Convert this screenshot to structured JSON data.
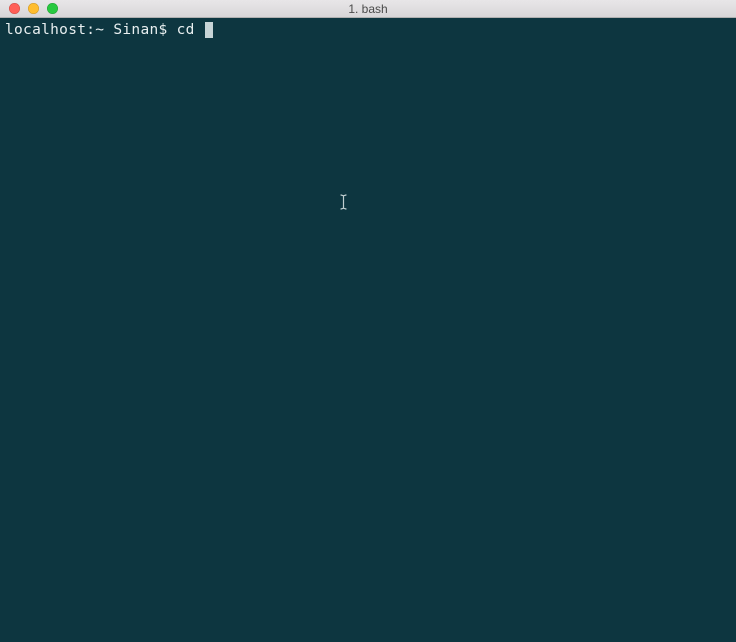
{
  "titlebar": {
    "title": "1. bash"
  },
  "terminal": {
    "prompt": "localhost:~ Sinan$ ",
    "command": "cd "
  },
  "colors": {
    "bg": "#0d3640",
    "fg": "#e8eff0",
    "cursor": "#c7d4d6",
    "close": "#ff5f57",
    "min": "#ffbd2e",
    "max": "#28c940"
  }
}
